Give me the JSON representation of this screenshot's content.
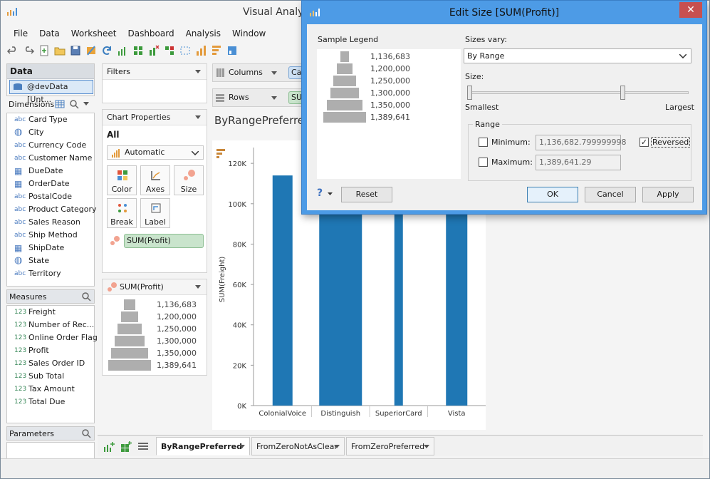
{
  "app": {
    "title": "Visual Analy"
  },
  "menu": [
    "File",
    "Data",
    "Worksheet",
    "Dashboard",
    "Analysis",
    "Window"
  ],
  "data_panel": {
    "title": "Data",
    "datasource": "@devData [Unt..."
  },
  "dimensions": {
    "title": "Dimensions",
    "items": [
      {
        "icon": "abc",
        "label": "Card Type"
      },
      {
        "icon": "globe",
        "label": "City"
      },
      {
        "icon": "abc",
        "label": "Currency Code"
      },
      {
        "icon": "abc",
        "label": "Customer Name"
      },
      {
        "icon": "calendar",
        "label": "DueDate"
      },
      {
        "icon": "calendar",
        "label": "OrderDate"
      },
      {
        "icon": "abc",
        "label": "PostalCode"
      },
      {
        "icon": "abc",
        "label": "Product Category"
      },
      {
        "icon": "abc",
        "label": "Sales Reason"
      },
      {
        "icon": "abc",
        "label": "Ship Method"
      },
      {
        "icon": "calendar",
        "label": "ShipDate"
      },
      {
        "icon": "globe",
        "label": "State"
      },
      {
        "icon": "abc",
        "label": "Territory"
      }
    ]
  },
  "measures": {
    "title": "Measures",
    "items": [
      {
        "icon": "123",
        "label": "Freight"
      },
      {
        "icon": "123",
        "label": "Number of Rec..."
      },
      {
        "icon": "123",
        "label": "Online Order Flag"
      },
      {
        "icon": "123",
        "label": "Profit"
      },
      {
        "icon": "123",
        "label": "Sales Order ID"
      },
      {
        "icon": "123",
        "label": "Sub Total"
      },
      {
        "icon": "123",
        "label": "Tax Amount"
      },
      {
        "icon": "123",
        "label": "Total Due"
      }
    ]
  },
  "parameters": {
    "title": "Parameters"
  },
  "filters": {
    "title": "Filters"
  },
  "chart_props": {
    "title": "Chart Properties",
    "tab": "All",
    "mark_type": "Automatic",
    "buttons": [
      "Color",
      "Axes",
      "Size",
      "Break",
      "Label"
    ],
    "size_pill": "SUM(Profit)"
  },
  "size_legend": {
    "title": "SUM(Profit)",
    "values": [
      "1,136,683",
      "1,200,000",
      "1,250,000",
      "1,300,000",
      "1,350,000",
      "1,389,641"
    ]
  },
  "shelves": {
    "columns_label": "Columns",
    "columns_pill": "Car",
    "rows_label": "Rows",
    "rows_pill": "SUM"
  },
  "sheet": {
    "title": "ByRangePreferred"
  },
  "chart_data": {
    "type": "bar",
    "categories": [
      "ColonialVoice",
      "Distinguish",
      "SuperiorCard",
      "Vista"
    ],
    "values": [
      114000,
      104000,
      103000,
      104000
    ],
    "ylabel": "SUM(Freight)",
    "yticks": [
      "0K",
      "20K",
      "40K",
      "60K",
      "80K",
      "100K",
      "120K"
    ],
    "ylim": [
      0,
      125000
    ],
    "color": "#1f77b4"
  },
  "tabs": [
    {
      "label": "ByRangePreferred",
      "active": true
    },
    {
      "label": "FromZeroNotAsClear",
      "active": false
    },
    {
      "label": "FromZeroPreferred",
      "active": false
    }
  ],
  "dialog": {
    "title": "Edit Size [SUM(Profit)]",
    "close": "✕",
    "sample_legend_label": "Sample Legend",
    "sample_values": [
      "1,136,683",
      "1,200,000",
      "1,250,000",
      "1,300,000",
      "1,350,000",
      "1,389,641"
    ],
    "sizes_vary_label": "Sizes vary:",
    "sizes_vary_value": "By Range",
    "size_label": "Size:",
    "smallest_label": "Smallest",
    "largest_label": "Largest",
    "range_label": "Range",
    "minimum_label": "Minimum:",
    "minimum_value": "1,136,682.799999998",
    "maximum_label": "Maximum:",
    "maximum_value": "1,389,641.29",
    "reversed_label": "Reversed",
    "reversed_checked": true,
    "help": "?",
    "reset": "Reset",
    "ok": "OK",
    "cancel": "Cancel",
    "apply": "Apply"
  }
}
